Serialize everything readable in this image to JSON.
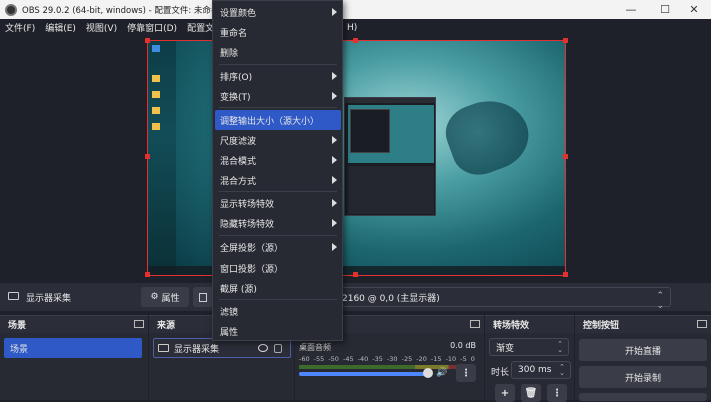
{
  "window": {
    "title": "OBS 29.0.2 (64-bit, windows) - 配置文件: 未命名 - 场景: 未命名",
    "controls": {
      "minimize": "—",
      "maximize": "☐",
      "close": "✕"
    }
  },
  "menubar": {
    "items": [
      "文件(F)",
      "编辑(E)",
      "视图(V)",
      "停靠窗口(D)",
      "配置文件"
    ],
    "trailing": "H)"
  },
  "source_toolbar": {
    "source_name": "显示器采集",
    "properties_label": "属性",
    "display_value": "2160 @ 0,0 (主显示器)"
  },
  "context_menu": {
    "items": [
      {
        "label": "设置颜色",
        "submenu": true
      },
      {
        "label": "重命名",
        "submenu": false
      },
      {
        "label": "删除",
        "submenu": false
      },
      {
        "label": "排序(O)",
        "submenu": true
      },
      {
        "label": "变换(T)",
        "submenu": true
      },
      {
        "label": "调整输出大小（源大小）",
        "submenu": false,
        "active": true
      },
      {
        "label": "尺度滤波",
        "submenu": true
      },
      {
        "label": "混合模式",
        "submenu": true
      },
      {
        "label": "混合方式",
        "submenu": true
      },
      {
        "label": "显示转场特效",
        "submenu": true
      },
      {
        "label": "隐藏转场特效",
        "submenu": true
      },
      {
        "label": "全屏投影（源）",
        "submenu": true
      },
      {
        "label": "窗口投影（源）",
        "submenu": false
      },
      {
        "label": "截屏 (源)",
        "submenu": false
      },
      {
        "label": "滤镜",
        "submenu": false
      },
      {
        "label": "属性",
        "submenu": false
      }
    ]
  },
  "docks": {
    "scenes": {
      "title": "场景",
      "items": [
        "场景"
      ]
    },
    "sources": {
      "title": "来源",
      "items": [
        "显示器采集"
      ]
    },
    "mixer": {
      "channel": "桌面音频",
      "db": "0.0 dB",
      "scale": [
        "-60",
        "-55",
        "-50",
        "-45",
        "-40",
        "-35",
        "-30",
        "-25",
        "-20",
        "-15",
        "-10",
        "-5",
        "0"
      ],
      "volume": 0.95
    },
    "transitions": {
      "title": "转场特效",
      "selected": "渐变",
      "duration_label": "时长",
      "duration": "300 ms",
      "add": "+",
      "more": "⋮"
    },
    "controls": {
      "title": "控制按钮",
      "buttons": [
        "开始直播",
        "开始录制"
      ]
    }
  },
  "colors": {
    "accent": "#2e59c6",
    "selection_border": "#e53030",
    "background": "#1f212a"
  }
}
